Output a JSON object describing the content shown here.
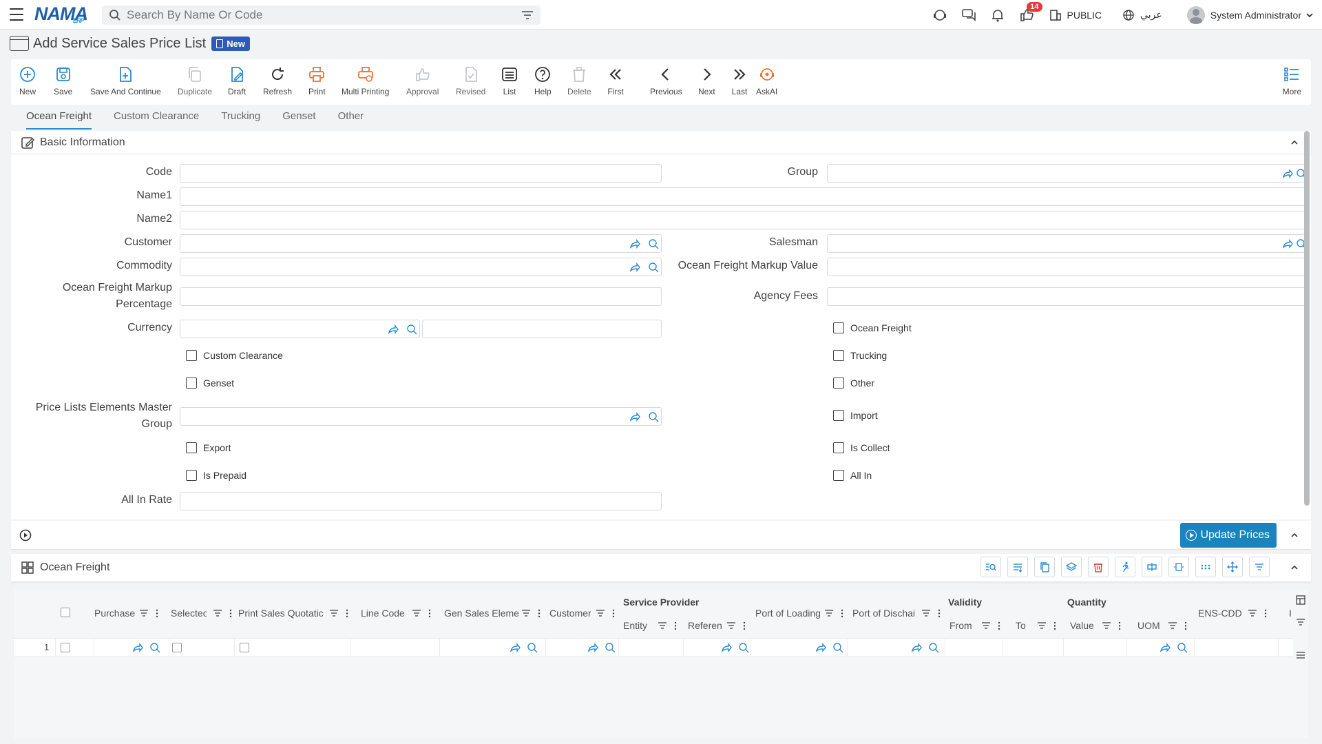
{
  "brand": {
    "logo": "NAMA",
    "logo_sub": "ERP"
  },
  "search": {
    "placeholder": "Search By Name Or Code"
  },
  "topbar": {
    "notification_count": "14",
    "public_label": "PUBLIC",
    "language": "عربي",
    "user": "System Administrator"
  },
  "page": {
    "title": "Add Service Sales Price List",
    "status_badge": "New"
  },
  "toolbar": {
    "items": [
      {
        "label": "New",
        "icon": "plus-circle-icon"
      },
      {
        "label": "Save",
        "icon": "save-icon"
      },
      {
        "label": "Save And Continue",
        "icon": "save-continue-icon"
      },
      {
        "label": "Duplicate",
        "icon": "duplicate-icon"
      },
      {
        "label": "Draft",
        "icon": "draft-icon"
      },
      {
        "label": "Refresh",
        "icon": "refresh-icon"
      },
      {
        "label": "Print",
        "icon": "print-icon"
      },
      {
        "label": "Multi Printing",
        "icon": "multi-print-icon"
      },
      {
        "label": "Approval",
        "icon": "approval-icon"
      },
      {
        "label": "Revised",
        "icon": "revised-icon"
      },
      {
        "label": "List",
        "icon": "list-icon"
      },
      {
        "label": "Help",
        "icon": "help-icon"
      },
      {
        "label": "Delete",
        "icon": "delete-icon"
      },
      {
        "label": "First",
        "icon": "first-icon"
      },
      {
        "label": "Previous",
        "icon": "previous-icon"
      },
      {
        "label": "Next",
        "icon": "next-icon"
      },
      {
        "label": "Last",
        "icon": "last-icon"
      },
      {
        "label": "AskAI",
        "icon": "askai-icon"
      }
    ],
    "more_label": "More"
  },
  "tabs": [
    "Ocean Freight",
    "Custom Clearance",
    "Trucking",
    "Genset",
    "Other"
  ],
  "basic_info": {
    "title": "Basic Information",
    "labels": {
      "code": "Code",
      "group": "Group",
      "name1": "Name1",
      "name2": "Name2",
      "customer": "Customer",
      "salesman": "Salesman",
      "commodity": "Commodity",
      "of_markup_value": "Ocean Freight Markup Value",
      "of_markup_pct_1": "Ocean Freight Markup",
      "of_markup_pct_2": "Percentage",
      "agency_fees": "Agency Fees",
      "currency": "Currency",
      "ple_master_1": "Price Lists Elements Master",
      "ple_master_2": "Group",
      "all_in_rate": "All In Rate"
    },
    "checkboxes": {
      "ocean_freight": "Ocean Freight",
      "custom_clearance": "Custom Clearance",
      "trucking": "Trucking",
      "genset": "Genset",
      "other": "Other",
      "import": "Import",
      "export": "Export",
      "is_collect": "Is Collect",
      "is_prepaid": "Is Prepaid",
      "all_in": "All In"
    }
  },
  "actions": {
    "update_prices": "Update Prices"
  },
  "grid": {
    "title": "Ocean Freight",
    "groups": {
      "service_provider": "Service Provider",
      "validity": "Validity",
      "quantity": "Quantity"
    },
    "columns": {
      "purchase": "Purchase I",
      "selected": "Selectec",
      "print_sales": "Print Sales Quotatic",
      "line_code": "Line Code",
      "gen_sales": "Gen Sales Eleme",
      "customer": "Customer",
      "entity_type": "Entity T",
      "reference": "Referen",
      "port_loading": "Port of Loading",
      "port_discharge": "Port of Dischai",
      "from": "From",
      "to": "To",
      "value": "Value",
      "uom": "UOM",
      "ens_cdd": "ENS-CDD",
      "extra": "I"
    },
    "row_number": "1"
  },
  "colors": {
    "accent": "#1a84bf",
    "badge": "#2d5bb7",
    "icon_blue": "#2a8ad4",
    "icon_orange": "#e8763a"
  }
}
